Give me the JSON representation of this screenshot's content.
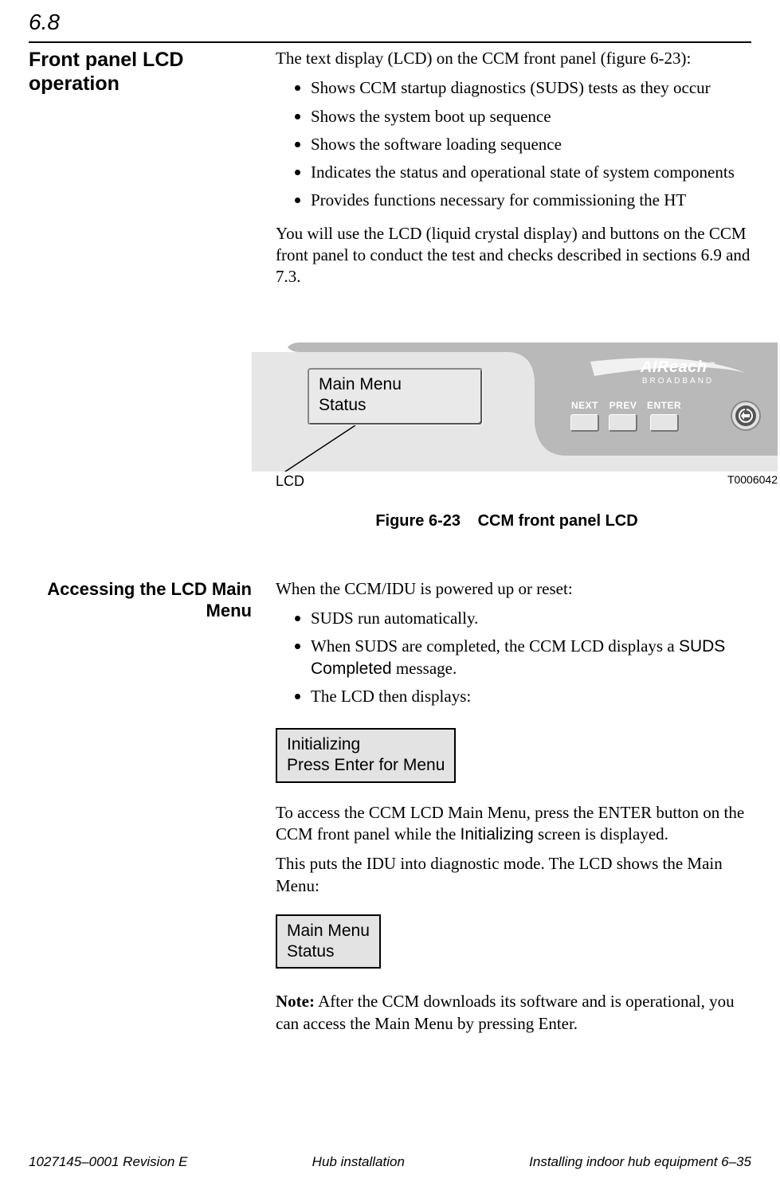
{
  "section_number": "6.8",
  "section_heading": "Front panel LCD operation",
  "intro_text": "The text display (LCD) on the CCM front panel (figure 6-23):",
  "bullets": [
    "Shows CCM startup diagnostics (SUDS) tests as they occur",
    "Shows the system boot up sequence",
    "Shows the software loading sequence",
    "Indicates the status and operational state of system components",
    "Provides functions necessary for commissioning the HT"
  ],
  "after_bullets": "You will use the LCD (liquid crystal display) and buttons on the CCM front panel to conduct the test and checks described in sections 6.9 and 7.3.",
  "panel": {
    "lcd_line1": "Main Menu",
    "lcd_line2": "Status",
    "buttons": {
      "next": "NEXT",
      "prev": "PREV",
      "enter": "ENTER"
    },
    "brand_main": "AIReach",
    "brand_tm": "™",
    "brand_sub": "BROADBAND"
  },
  "figure": {
    "label_pointer": "LCD",
    "drawing_id": "T0006042",
    "caption_num": "Figure  6-23",
    "caption_text": "CCM front panel LCD"
  },
  "sub_heading": "Accessing the LCD Main Menu",
  "sub_intro": "When the CCM/IDU is powered up or reset:",
  "sub_bullets_pre": "SUDS run automatically.",
  "sub_bullets_mid_a": "When SUDS are completed, the CCM LCD displays a ",
  "sub_bullets_mid_b": "SUDS Completed",
  "sub_bullets_mid_c": " message.",
  "sub_bullets_post": "The LCD then displays:",
  "box1_line1": "Initializing",
  "box1_line2": "Press Enter for Menu",
  "after_box1_a": "To access the CCM LCD Main Menu, press the ENTER button on the CCM front panel while the ",
  "after_box1_b": "Initializing",
  "after_box1_c": " screen is displayed.",
  "after_box1_2": "This puts the IDU into diagnostic mode. The LCD shows the Main Menu:",
  "box2_line1": "Main Menu",
  "box2_line2": "Status",
  "note_label": "Note:",
  "note_text": " After the CCM downloads its software and is operational, you can access the Main Menu by pressing Enter.",
  "footer": {
    "left": "1027145–0001  Revision E",
    "mid": "Hub installation",
    "right": "Installing indoor hub equipment   6–35"
  }
}
